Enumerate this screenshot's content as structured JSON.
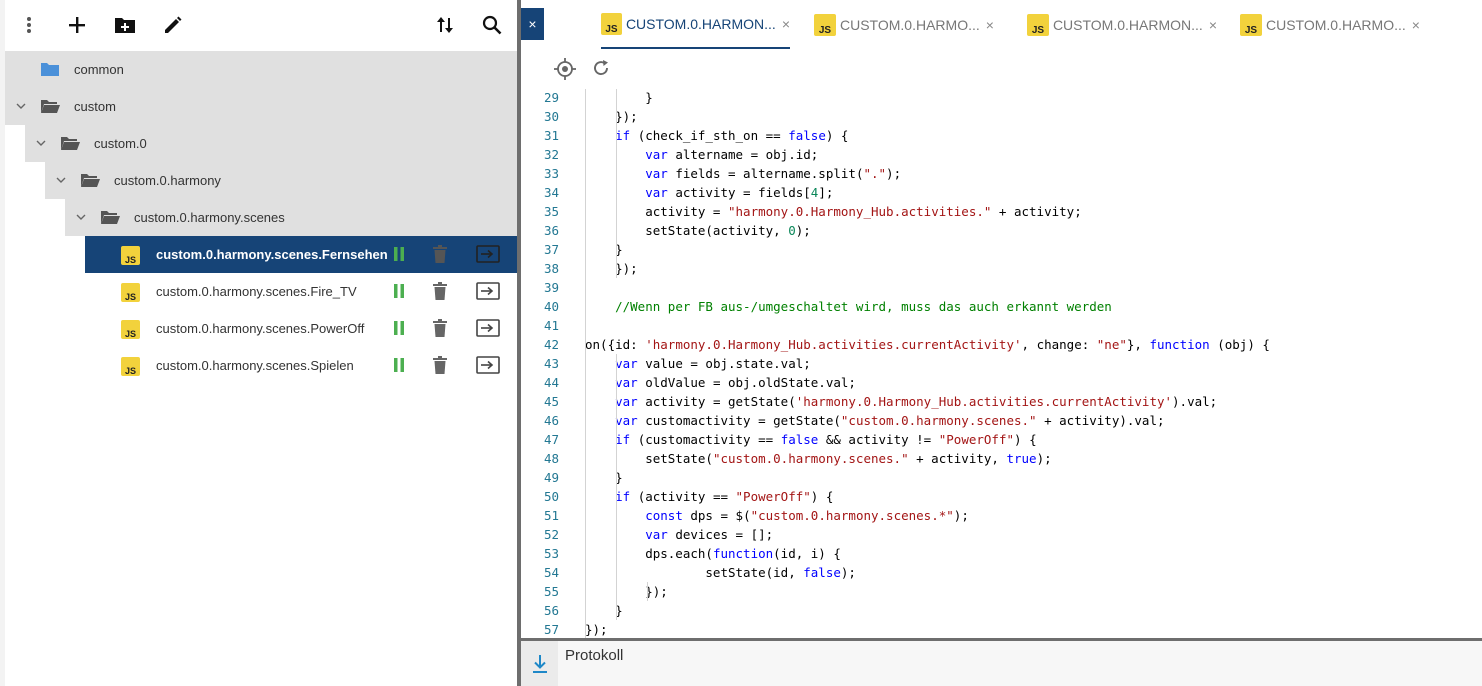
{
  "toolbar": {
    "icons": [
      "more-vert-icon",
      "add-icon",
      "add-folder-icon",
      "edit-icon",
      "sort-icon",
      "search-icon"
    ]
  },
  "tree": {
    "folders": [
      {
        "label": "common"
      },
      {
        "label": "custom"
      },
      {
        "label": "custom.0"
      },
      {
        "label": "custom.0.harmony"
      },
      {
        "label": "custom.0.harmony.scenes"
      }
    ],
    "scripts": [
      {
        "label": "custom.0.harmony.scenes.Fernsehen",
        "selected": true
      },
      {
        "label": "custom.0.harmony.scenes.Fire_TV",
        "selected": false
      },
      {
        "label": "custom.0.harmony.scenes.PowerOff",
        "selected": false
      },
      {
        "label": "custom.0.harmony.scenes.Spielen",
        "selected": false
      }
    ],
    "badge_text": "JS"
  },
  "tabs": [
    {
      "title": "CUSTOM.0.HARMON...",
      "close": "×",
      "active": true
    },
    {
      "title": "CUSTOM.0.HARMO...",
      "close": "×",
      "active": false
    },
    {
      "title": "CUSTOM.0.HARMON...",
      "close": "×",
      "active": false
    },
    {
      "title": "CUSTOM.0.HARMO...",
      "close": "×",
      "active": false
    }
  ],
  "close_all": "×",
  "editor": {
    "first_line": 29,
    "lines": [
      [
        [
          "t",
          "        }"
        ]
      ],
      [
        [
          "t",
          "    });"
        ]
      ],
      [
        [
          "t",
          "    "
        ],
        [
          "k",
          "if"
        ],
        [
          "t",
          " (check_if_sth_on == "
        ],
        [
          "k",
          "false"
        ],
        [
          "t",
          ") {"
        ]
      ],
      [
        [
          "t",
          "        "
        ],
        [
          "k",
          "var"
        ],
        [
          "t",
          " altername = obj.id;"
        ]
      ],
      [
        [
          "t",
          "        "
        ],
        [
          "k",
          "var"
        ],
        [
          "t",
          " fields = altername.split("
        ],
        [
          "s",
          "\".\""
        ],
        [
          "t",
          ");"
        ]
      ],
      [
        [
          "t",
          "        "
        ],
        [
          "k",
          "var"
        ],
        [
          "t",
          " activity = fields["
        ],
        [
          "n",
          "4"
        ],
        [
          "t",
          "];"
        ]
      ],
      [
        [
          "t",
          "        activity = "
        ],
        [
          "s",
          "\"harmony.0.Harmony_Hub.activities.\""
        ],
        [
          "t",
          " + activity;"
        ]
      ],
      [
        [
          "t",
          "        setState(activity, "
        ],
        [
          "n",
          "0"
        ],
        [
          "t",
          ");"
        ]
      ],
      [
        [
          "t",
          "    }"
        ]
      ],
      [
        [
          "t",
          "    });"
        ]
      ],
      [
        [
          "t",
          ""
        ]
      ],
      [
        [
          "t",
          "    "
        ],
        [
          "c",
          "//Wenn per FB aus-/umgeschaltet wird, muss das auch erkannt werden"
        ]
      ],
      [
        [
          "t",
          ""
        ]
      ],
      [
        [
          "t",
          "on({id: "
        ],
        [
          "s",
          "'harmony.0.Harmony_Hub.activities.currentActivity'"
        ],
        [
          "t",
          ", change: "
        ],
        [
          "s",
          "\"ne\""
        ],
        [
          "t",
          "}, "
        ],
        [
          "k",
          "function"
        ],
        [
          "t",
          " (obj) {"
        ]
      ],
      [
        [
          "t",
          "    "
        ],
        [
          "k",
          "var"
        ],
        [
          "t",
          " value = obj.state.val;"
        ]
      ],
      [
        [
          "t",
          "    "
        ],
        [
          "k",
          "var"
        ],
        [
          "t",
          " oldValue = obj.oldState.val;"
        ]
      ],
      [
        [
          "t",
          "    "
        ],
        [
          "k",
          "var"
        ],
        [
          "t",
          " activity = getState("
        ],
        [
          "s",
          "'harmony.0.Harmony_Hub.activities.currentActivity'"
        ],
        [
          "t",
          ").val;"
        ]
      ],
      [
        [
          "t",
          "    "
        ],
        [
          "k",
          "var"
        ],
        [
          "t",
          " customactivity = getState("
        ],
        [
          "s",
          "\"custom.0.harmony.scenes.\""
        ],
        [
          "t",
          " + activity).val;"
        ]
      ],
      [
        [
          "t",
          "    "
        ],
        [
          "k",
          "if"
        ],
        [
          "t",
          " (customactivity == "
        ],
        [
          "k",
          "false"
        ],
        [
          "t",
          " && activity != "
        ],
        [
          "s",
          "\"PowerOff\""
        ],
        [
          "t",
          ") {"
        ]
      ],
      [
        [
          "t",
          "        setState("
        ],
        [
          "s",
          "\"custom.0.harmony.scenes.\""
        ],
        [
          "t",
          " + activity, "
        ],
        [
          "k",
          "true"
        ],
        [
          "t",
          ");"
        ]
      ],
      [
        [
          "t",
          "    }"
        ]
      ],
      [
        [
          "t",
          "    "
        ],
        [
          "k",
          "if"
        ],
        [
          "t",
          " (activity == "
        ],
        [
          "s",
          "\"PowerOff\""
        ],
        [
          "t",
          ") {"
        ]
      ],
      [
        [
          "t",
          "        "
        ],
        [
          "k",
          "const"
        ],
        [
          "t",
          " dps = $("
        ],
        [
          "s",
          "\"custom.0.harmony.scenes.*\""
        ],
        [
          "t",
          ");"
        ]
      ],
      [
        [
          "t",
          "        "
        ],
        [
          "k",
          "var"
        ],
        [
          "t",
          " devices = [];"
        ]
      ],
      [
        [
          "t",
          "        dps.each("
        ],
        [
          "k",
          "function"
        ],
        [
          "t",
          "(id, i) {"
        ]
      ],
      [
        [
          "t",
          "                setState(id, "
        ],
        [
          "k",
          "false"
        ],
        [
          "t",
          ");"
        ]
      ],
      [
        [
          "t",
          "        });"
        ]
      ],
      [
        [
          "t",
          "    }"
        ]
      ],
      [
        [
          "t",
          "});"
        ]
      ]
    ]
  },
  "log": {
    "label": "Protokoll"
  },
  "colors": {
    "accent": "#164477",
    "js_badge": "#f2d23c",
    "run_icon": "#4caf50",
    "keyword": "#0000ff",
    "string": "#a31515",
    "comment": "#008000",
    "number": "#098658",
    "line_number": "#237893"
  }
}
